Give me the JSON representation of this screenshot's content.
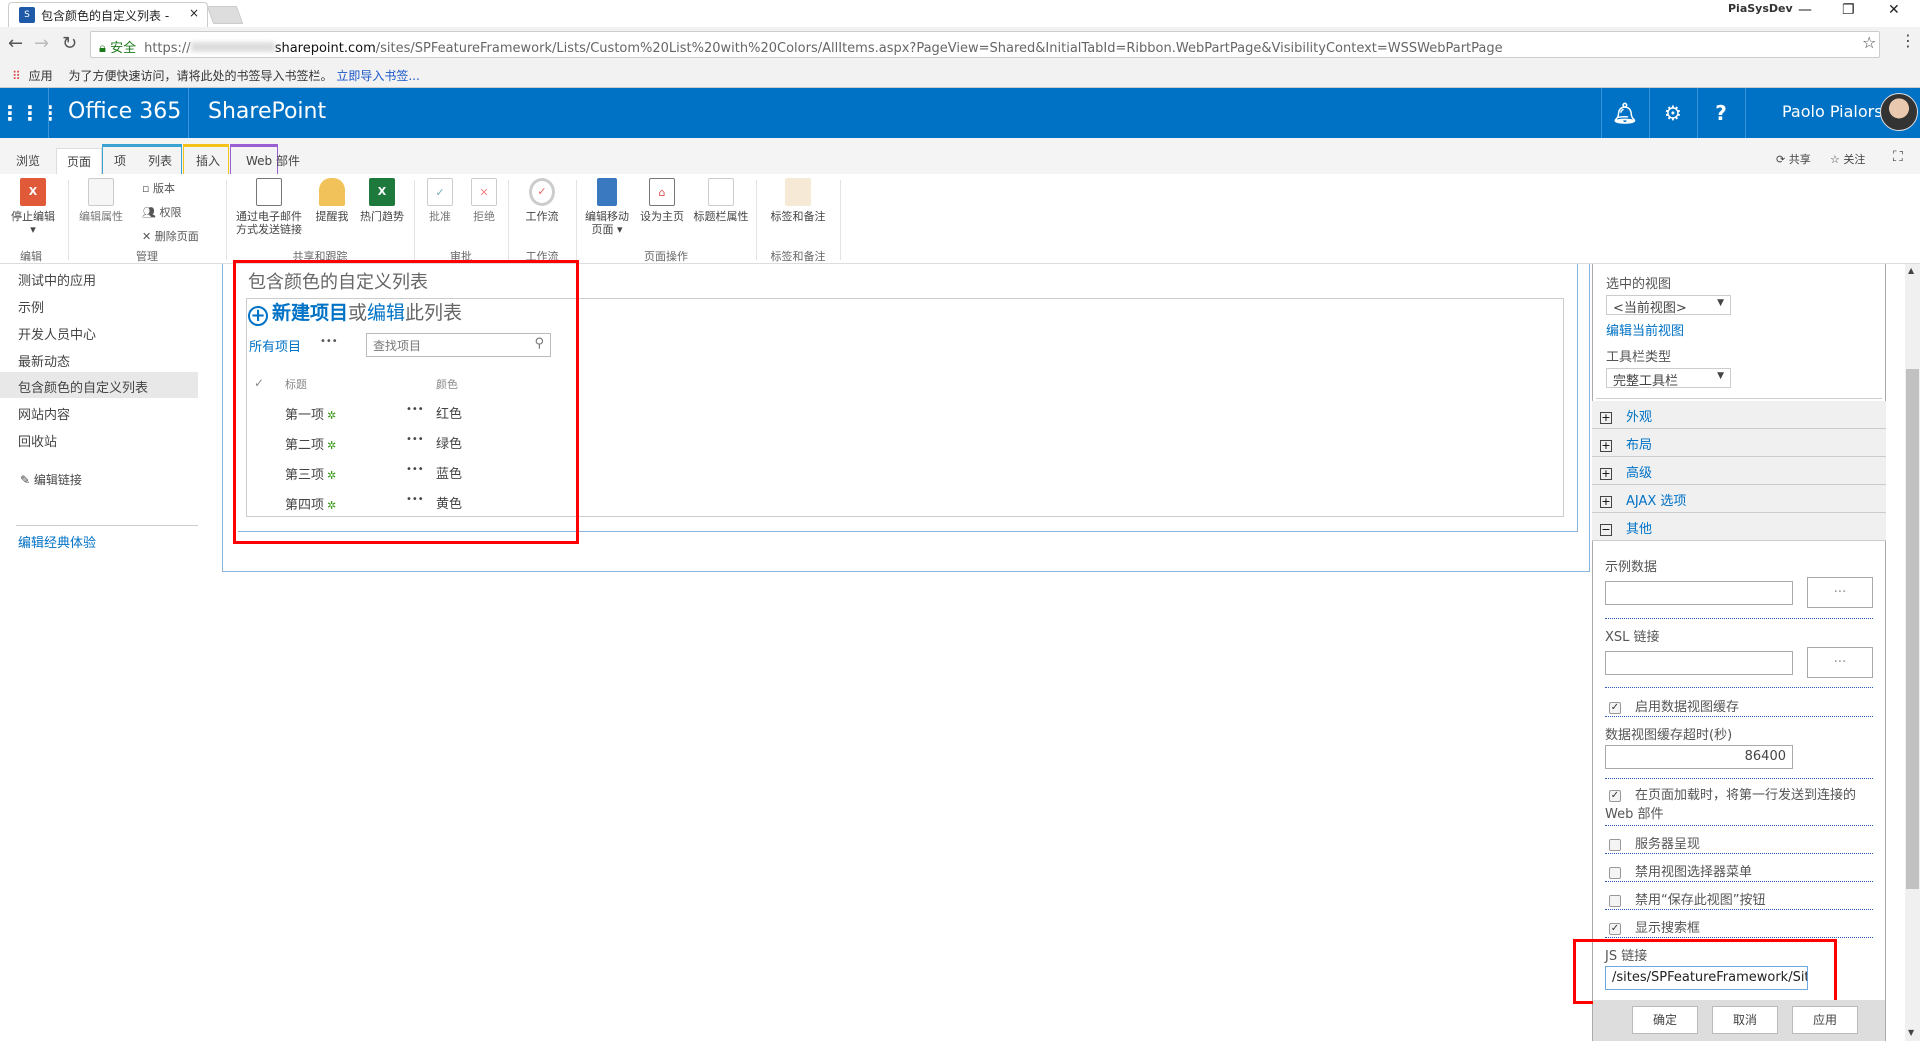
{
  "browser": {
    "tab_title": "包含颜色的自定义列表 -",
    "tab_close": "×",
    "profile": "PiaSysDev",
    "secure_label": "安全",
    "url_prefix": "https://",
    "url_host": "sharepoint.com",
    "url_rest": "/sites/SPFeatureFramework/Lists/Custom%20List%20with%20Colors/AllItems.aspx?PageView=Shared&InitialTabId=Ribbon.WebPartPage&VisibilityContext=WSSWebPartPage",
    "apps_label": "应用",
    "bookmark_hint": "为了方便快速访问，请将此处的书签导入书签栏。",
    "bookmark_import": "立即导入书签..."
  },
  "suite": {
    "app_launcher": "waffle-icon",
    "office": "Office 365",
    "product": "SharePoint",
    "user": "Paolo Pialorsi",
    "color": "#0072c6"
  },
  "ribbon": {
    "tabs": [
      "浏览",
      "页面",
      "项",
      "列表",
      "插入",
      "Web 部件"
    ],
    "actions": {
      "share": "共享",
      "follow": "关注"
    },
    "groups": [
      {
        "label": "编辑",
        "buttons": [
          "停止编辑"
        ]
      },
      {
        "label": "管理",
        "buttons": [
          "编辑属性",
          "版本",
          "权限",
          "删除页面"
        ]
      },
      {
        "label": "共享和跟踪",
        "buttons": [
          "通过电子邮件方式发送链接",
          "提醒我",
          "热门趋势"
        ]
      },
      {
        "label": "审批",
        "buttons": [
          "批准",
          "拒绝"
        ]
      },
      {
        "label": "工作流",
        "buttons": [
          "工作流"
        ]
      },
      {
        "label": "页面操作",
        "buttons": [
          "编辑移动页面",
          "设为主页",
          "标题栏属性"
        ]
      },
      {
        "label": "标签和备注",
        "buttons": [
          "标签和备注"
        ]
      }
    ]
  },
  "leftnav": {
    "items": [
      "测试中的应用",
      "示例",
      "开发人员中心",
      "最新动态",
      "包含颜色的自定义列表",
      "网站内容",
      "回收站"
    ],
    "edit_links": "编辑链接",
    "classic": "编辑经典体验"
  },
  "webpart": {
    "title": "包含颜色的自定义列表",
    "new_item": "新建项目",
    "or": "或",
    "edit": "编辑",
    "this_list": "此列表",
    "view": "所有项目",
    "more": "•••",
    "search_placeholder": "查找项目",
    "columns": [
      "标题",
      "颜色"
    ],
    "rows": [
      {
        "title": "第一项",
        "color": "红色"
      },
      {
        "title": "第二项",
        "color": "绿色"
      },
      {
        "title": "第三项",
        "color": "蓝色"
      },
      {
        "title": "第四项",
        "color": "黄色"
      }
    ]
  },
  "pane": {
    "selected_view_label": "选中的视图",
    "selected_view": "<当前视图>",
    "edit_view": "编辑当前视图",
    "toolbar_label": "工具栏类型",
    "toolbar": "完整工具栏",
    "sections": [
      "外观",
      "布局",
      "高级",
      "AJAX 选项",
      "其他"
    ],
    "sample_data": "示例数据",
    "xsl_link": "XSL 链接",
    "browse": "...",
    "cache": {
      "label": "启用数据视图缓存",
      "checked": true
    },
    "timeout_label": "数据视图缓存超时(秒)",
    "timeout": "86400",
    "send_first_row": {
      "label": "在页面加载时，将第一行发送到连接的 Web 部件",
      "checked": true
    },
    "server_render": {
      "label": "服务器呈现",
      "checked": false
    },
    "disable_view_selector": {
      "label": "禁用视图选择器菜单",
      "checked": false
    },
    "disable_save_view": {
      "label": "禁用“保存此视图”按钮",
      "checked": false
    },
    "show_search": {
      "label": "显示搜索框",
      "checked": true
    },
    "js_link_label": "JS 链接",
    "js_link": "/sites/SPFeatureFramework/Sit",
    "buttons": [
      "确定",
      "取消",
      "应用"
    ]
  }
}
